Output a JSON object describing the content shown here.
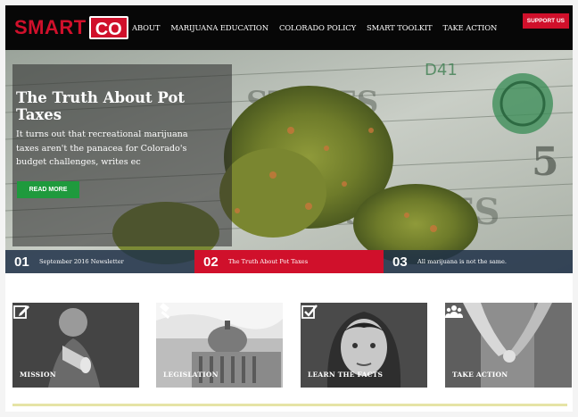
{
  "header": {
    "logo_smart": "SMART",
    "logo_co": "CO",
    "nav": [
      "ABOUT",
      "MARIJUANA EDUCATION",
      "COLORADO POLICY",
      "SMART TOOLKIT",
      "TAKE ACTION"
    ],
    "support_label": "SUPPORT US"
  },
  "hero": {
    "title": "The Truth About Pot Taxes",
    "text": "It turns out that recreational marijuana taxes aren't the panacea for Colorado's budget challenges, writes ec",
    "button_label": "READ MORE",
    "slides": [
      {
        "num": "01",
        "label": "September 2016 Newsletter"
      },
      {
        "num": "02",
        "label": "The Truth About Pot Taxes"
      },
      {
        "num": "03",
        "label": "All marijuana is not the same."
      }
    ]
  },
  "tiles": [
    {
      "label": "MISSION",
      "icon": "edit-icon"
    },
    {
      "label": "LEGISLATION",
      "icon": "gavel-icon"
    },
    {
      "label": "LEARN THE FACTS",
      "icon": "checkbox-icon"
    },
    {
      "label": "TAKE ACTION",
      "icon": "people-icon"
    }
  ],
  "colors": {
    "brand_red": "#d0102b",
    "green": "#1f9a3d",
    "header": "#070707"
  }
}
